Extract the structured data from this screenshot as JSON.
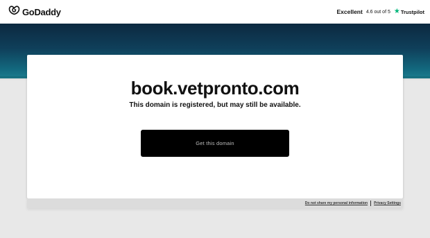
{
  "header": {
    "logo_text": "GoDaddy",
    "rating_label": "Excellent",
    "rating_score": "4.6 out of 5",
    "rating_source": "Trustpilot"
  },
  "main": {
    "domain": "book.vetpronto.com",
    "subtitle": "This domain is registered, but may still be available.",
    "cta_label": "Get this domain"
  },
  "footer": {
    "links": [
      "Do not share my personal information",
      "Privacy Settings"
    ]
  },
  "colors": {
    "band_top": "#0c2940",
    "band_bottom": "#1b7d8e",
    "trustpilot_star": "#00b67a",
    "cta_bg": "#000000"
  },
  "icons": [
    "godaddy-logo-icon",
    "trustpilot-star-icon"
  ]
}
